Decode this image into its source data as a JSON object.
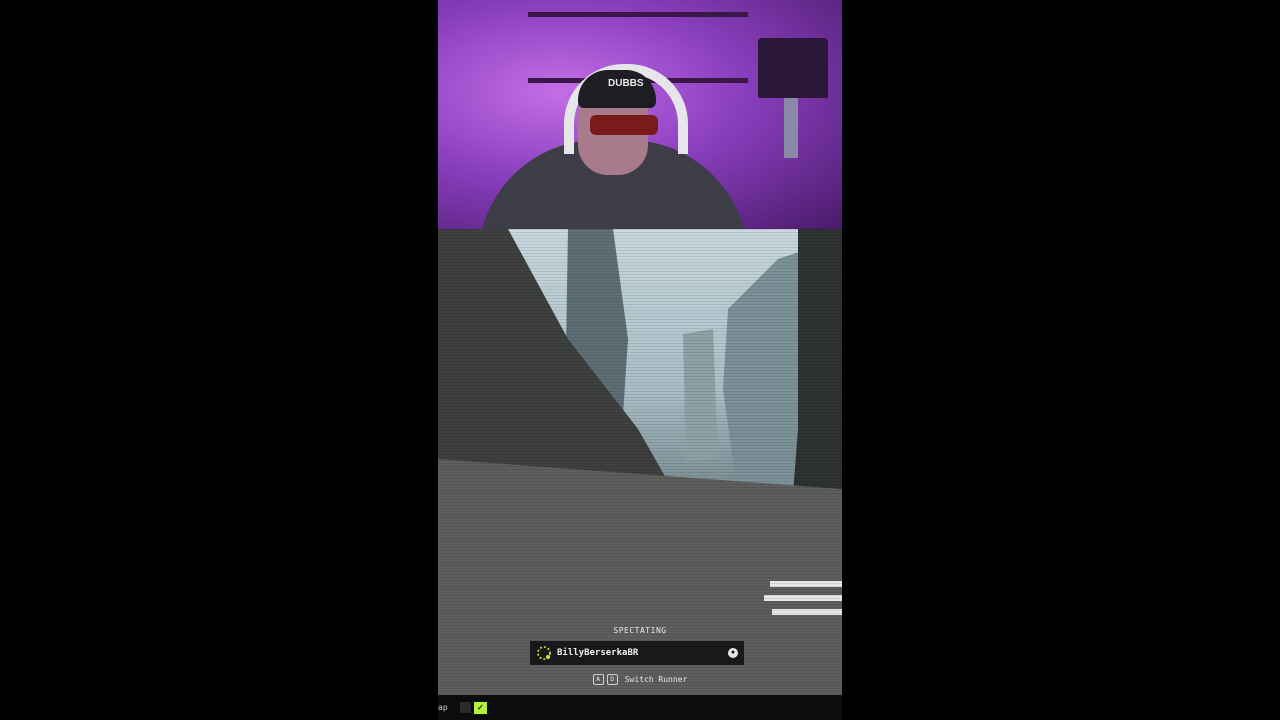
{
  "webcam": {
    "cap_text": "DUBBS"
  },
  "hud": {
    "spectating_label": "SPECTATING",
    "runner_name": "BillyBerserkaBR",
    "key_a": "A",
    "key_d": "D",
    "switch_label": "Switch Runner"
  },
  "bottombar": {
    "text": "ap",
    "check": "✓"
  },
  "colors": {
    "accent_lime": "#b7f23a",
    "webcam_purple": "#b060e0"
  }
}
